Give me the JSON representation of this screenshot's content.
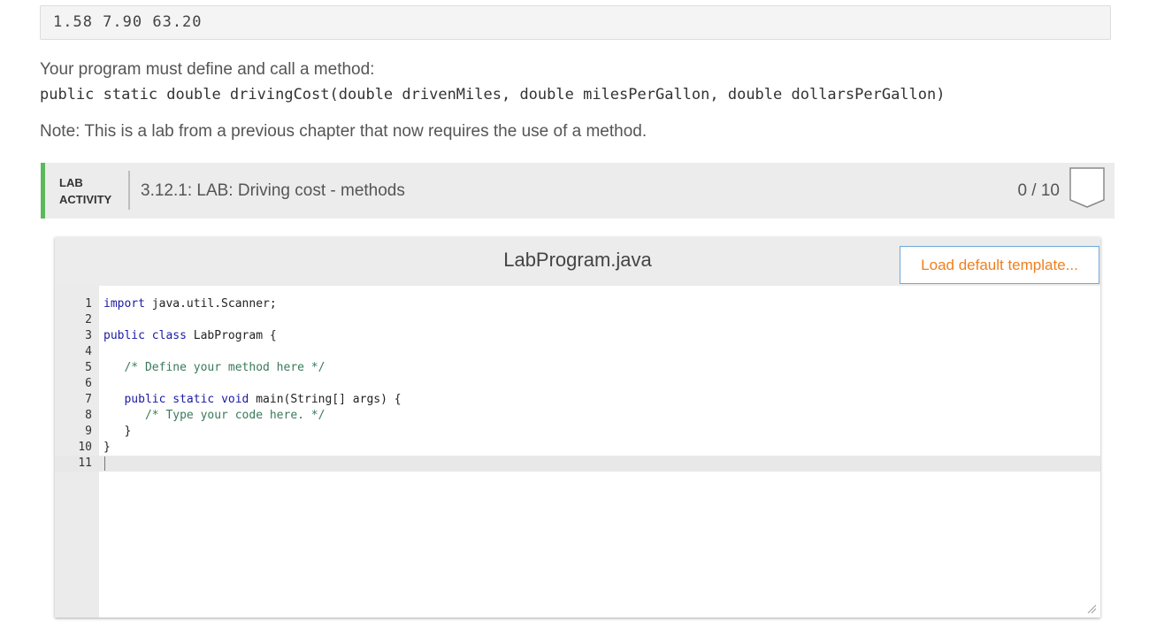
{
  "sample_output": "1.58 7.90 63.20",
  "instructions": {
    "define_text": "Your program must define and call a method:",
    "signature": "public static double drivingCost(double drivenMiles, double milesPerGallon, double dollarsPerGallon)",
    "note": "Note: This is a lab from a previous chapter that now requires the use of a method."
  },
  "lab": {
    "tag_line1": "LAB",
    "tag_line2": "ACTIVITY",
    "title": "3.12.1: LAB: Driving cost - methods",
    "score": "0 / 10",
    "accent_color": "#5cb85c"
  },
  "editor": {
    "file_name": "LabProgram.java",
    "load_button": "Load default template...",
    "lines": [
      {
        "n": "1",
        "code": "import java.util.Scanner;"
      },
      {
        "n": "2",
        "code": ""
      },
      {
        "n": "3",
        "code": "public class LabProgram {"
      },
      {
        "n": "4",
        "code": ""
      },
      {
        "n": "5",
        "code": "   /* Define your method here */"
      },
      {
        "n": "6",
        "code": ""
      },
      {
        "n": "7",
        "code": "   public static void main(String[] args) {"
      },
      {
        "n": "8",
        "code": "      /* Type your code here. */"
      },
      {
        "n": "9",
        "code": "   }"
      },
      {
        "n": "10",
        "code": "}"
      },
      {
        "n": "11",
        "code": ""
      }
    ]
  }
}
